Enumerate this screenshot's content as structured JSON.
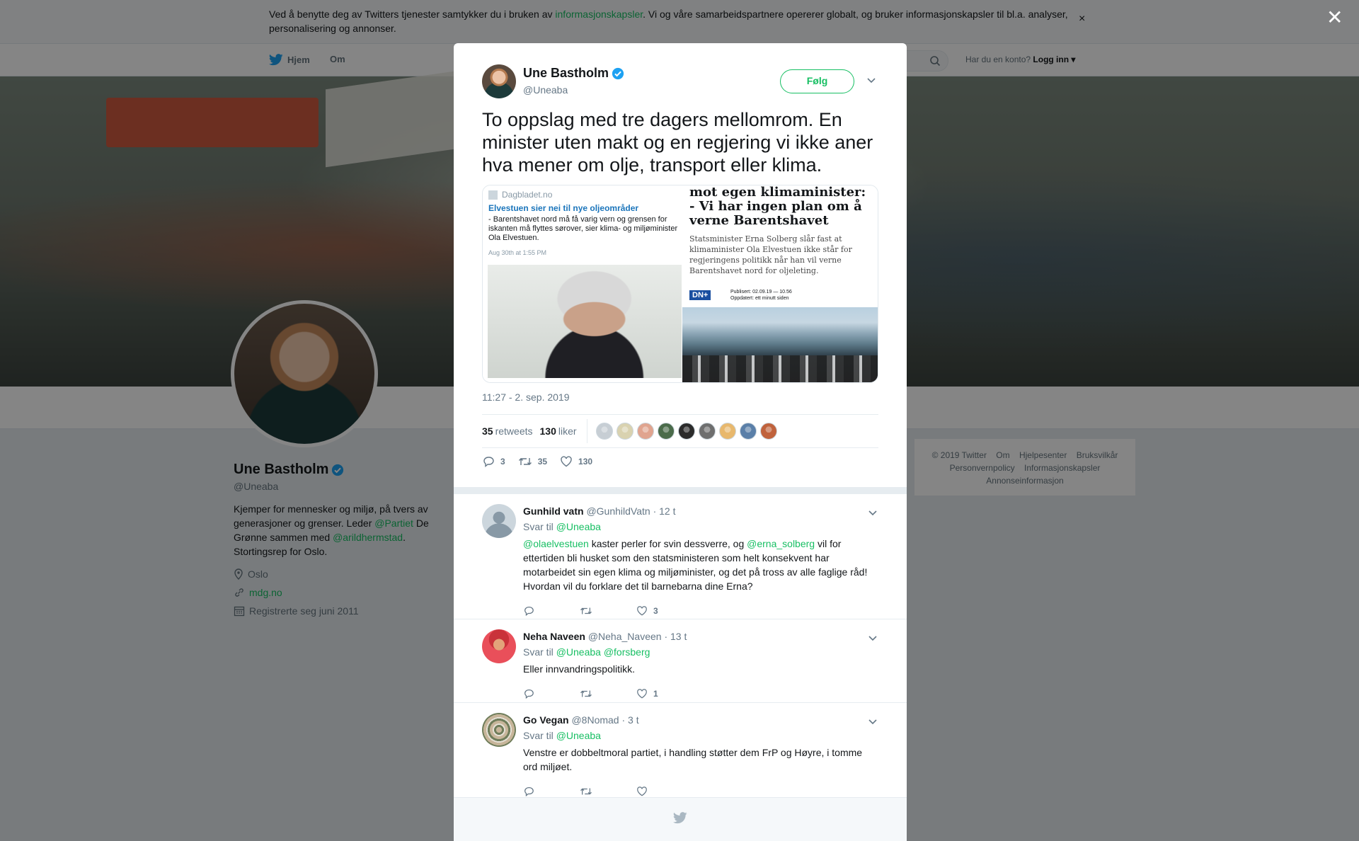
{
  "cookie_banner": {
    "text_before": "Ved å benytte deg av Twitters tjenester samtykker du i bruken av ",
    "link": "informasjonskapsler",
    "text_after": ". Vi og våre samarbeidspartnere opererer globalt, og bruker informasjonskapsler til bl.a. analyser, personalisering og annonser.",
    "close": "×"
  },
  "nav": {
    "home": "Hjem",
    "about": "Om",
    "account_prompt": "Har du en konto?",
    "login": "Logg inn"
  },
  "profile": {
    "name": "Une Bastholm",
    "handle": "@Uneaba",
    "bio_1": "Kjemper for mennesker og miljø, på tvers av generasjoner og grenser. Leder ",
    "bio_link_1": "@Partiet",
    "bio_2": " De Grønne sammen med ",
    "bio_link_2": "@arildhermstad",
    "bio_3": ". Stortingsrep for Oslo.",
    "location": "Oslo",
    "website": "mdg.no",
    "joined": "Registrerte seg juni 2011"
  },
  "footer": {
    "copyright": "© 2019 Twitter",
    "links": [
      "Om",
      "Hjelpesenter",
      "Bruksvilkår",
      "Personvernpolicy",
      "Informasjonskapsler",
      "Annonseinformasjon"
    ]
  },
  "overlay_close": "✕",
  "tweet": {
    "author": "Une Bastholm",
    "handle": "@Uneaba",
    "follow": "Følg",
    "text": "To oppslag med tre dagers mellomrom. En minister uten makt og en regjering vi ikke aner hva mener om olje, transport eller klima.",
    "media": {
      "left_source": "Dagbladet.no",
      "left_headline": "Elvestuen sier nei til nye oljeområder",
      "left_sub": "- Barentshavet nord må få varig vern og grensen for iskanten må flyttes sørover, sier klima- og miljøminister Ola Elvestuen.",
      "left_date": "Aug 30th at 1:55 PM",
      "right_headline": "mot egen klimaminister: - Vi har ingen plan om å verne Barentshavet",
      "right_sub": "Statsminister Erna Solberg slår fast at klimaminister Ola Elvestuen ikke står for regjeringens politikk når han vil verne Barentshavet nord for oljeleting.",
      "right_logo": "DN+",
      "right_published": "Publisert: 02.09.19 — 10.56",
      "right_updated": "Oppdatert: ett minutt siden"
    },
    "timestamp": "11:27 - 2. sep. 2019",
    "retweets_count": "35",
    "retweets_label": "retweets",
    "likes_count": "130",
    "likes_label": "liker",
    "liker_colors": [
      "#c7ced4",
      "#d9d2b0",
      "#e0a48f",
      "#4a6b4a",
      "#2b2b2b",
      "#6e6e6e",
      "#e8b86d",
      "#5a7fa8",
      "#c0623c"
    ],
    "actions": {
      "replies": "3",
      "retweets": "35",
      "likes": "130"
    }
  },
  "replies": [
    {
      "name": "Gunhild vatn",
      "handle": "@GunhildVatn",
      "time": "· 12 t",
      "reply_to_label": "Svar til",
      "reply_to": "@Uneaba",
      "mention_1": "@olaelvestuen",
      "text_1": " kaster perler for svin dessverre, og ",
      "mention_2": "@erna_solberg",
      "text_2": " vil for ettertiden bli husket som den statsministeren som helt konsekvent har motarbeidet sin egen klima og miljøminister, og det på tross av alle faglige råd! Hvordan vil du forklare det til barnebarna dine Erna?",
      "likes": "3"
    },
    {
      "name": "Neha Naveen",
      "handle": "@Neha_Naveen",
      "time": "· 13 t",
      "reply_to_label": "Svar til",
      "reply_to": "@Uneaba @forsberg",
      "text": "Eller innvandringspolitikk.",
      "likes": "1"
    },
    {
      "name": "Go Vegan",
      "handle": "@8Nomad",
      "time": "· 3 t",
      "reply_to_label": "Svar til",
      "reply_to": "@Uneaba",
      "text": "Venstre er dobbeltmoral partiet, i handling støtter dem FrP og Høyre, i tomme ord miljøet.",
      "likes": ""
    }
  ],
  "colors": {
    "accent": "#17bf63",
    "link": "#1da1f2",
    "muted": "#657786"
  }
}
